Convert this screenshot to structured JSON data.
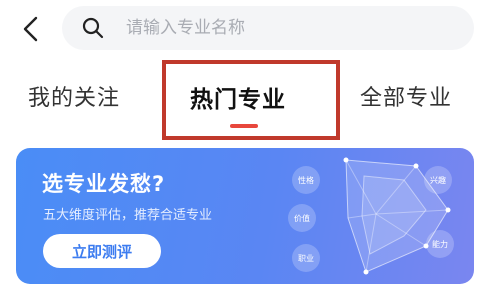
{
  "search": {
    "placeholder": "请输入专业名称"
  },
  "tabs": [
    {
      "label": "我的关注"
    },
    {
      "label": "热门专业"
    },
    {
      "label": "全部专业"
    }
  ],
  "banner": {
    "title": "选专业发愁?",
    "subtitle": "五大维度评估，推荐合适专业",
    "button_label": "立即测评",
    "radar_labels": [
      "性格",
      "兴趣",
      "价值",
      "能力",
      "职业"
    ]
  },
  "colors": {
    "accent_red": "#e8473c",
    "highlight_border": "#c0392b",
    "banner_blue": "#4a8df6"
  }
}
